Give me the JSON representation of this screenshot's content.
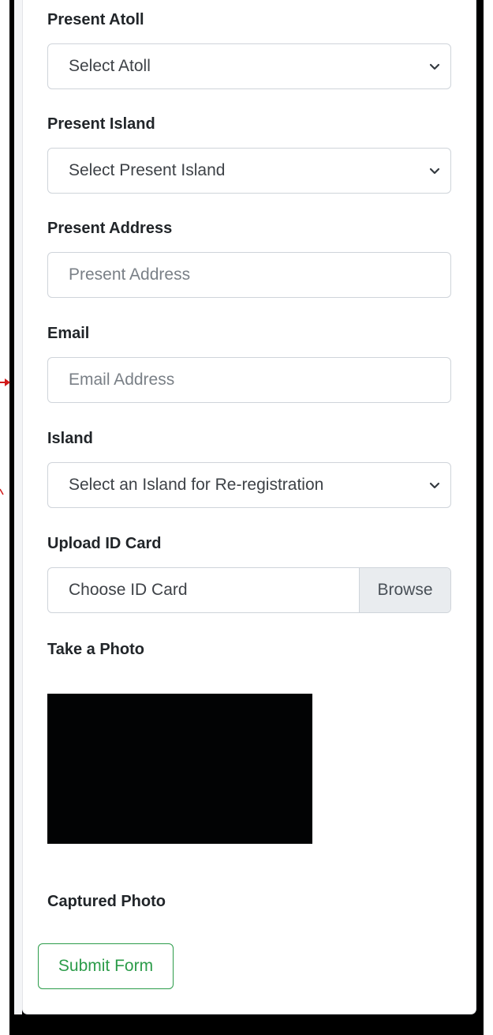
{
  "form": {
    "present_atoll": {
      "label": "Present Atoll",
      "value": "Select Atoll"
    },
    "present_island": {
      "label": "Present Island",
      "value": "Select Present Island"
    },
    "present_address": {
      "label": "Present Address",
      "placeholder": "Present Address"
    },
    "email": {
      "label": "Email",
      "placeholder": "Email Address"
    },
    "island": {
      "label": "Island",
      "value": "Select an Island for Re-registration"
    },
    "upload_id": {
      "label": "Upload ID Card",
      "placeholder": "Choose ID Card",
      "browse_label": "Browse"
    },
    "take_photo": {
      "label": "Take a Photo"
    },
    "captured_photo": {
      "label": "Captured Photo"
    },
    "submit_label": "Submit Form"
  },
  "icons": {
    "select_chevron": "chevron-down-icon",
    "annotation_arrow": "arrow-right-icon"
  },
  "colors": {
    "submit_accent": "#2c9c4a",
    "annotation_arrow": "#d11a1a",
    "frame": "#000000",
    "browse_bg": "#e9ecef"
  }
}
